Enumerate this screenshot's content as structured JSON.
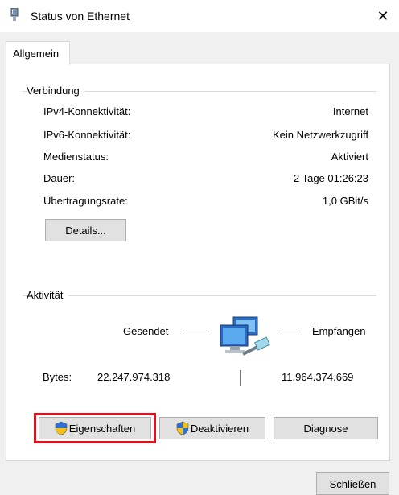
{
  "window": {
    "title": "Status von Ethernet",
    "close_glyph": "✕"
  },
  "tabs": [
    {
      "label": "Allgemein"
    }
  ],
  "connection": {
    "heading": "Verbindung",
    "rows": [
      {
        "label": "IPv4-Konnektivität:",
        "value": "Internet"
      },
      {
        "label": "IPv6-Konnektivität:",
        "value": "Kein Netzwerkzugriff"
      },
      {
        "label": "Medienstatus:",
        "value": "Aktiviert"
      },
      {
        "label": "Dauer:",
        "value": "2 Tage 01:26:23"
      },
      {
        "label": "Übertragungsrate:",
        "value": "1,0 GBit/s"
      }
    ],
    "details_button": "Details..."
  },
  "activity": {
    "heading": "Aktivität",
    "sent_label": "Gesendet",
    "received_label": "Empfangen",
    "bytes_label": "Bytes:",
    "bytes_sent": "22.247.974.318",
    "bytes_received": "11.964.374.669",
    "icon": "network-computers-icon"
  },
  "buttons": {
    "properties": "Eigenschaften",
    "deactivate": "Deaktivieren",
    "diagnose": "Diagnose",
    "close": "Schließen",
    "shield_icon": "uac-shield-icon"
  },
  "colors": {
    "highlight": "#e01020",
    "window_bg": "#f0f0f0",
    "panel_bg": "#ffffff"
  }
}
